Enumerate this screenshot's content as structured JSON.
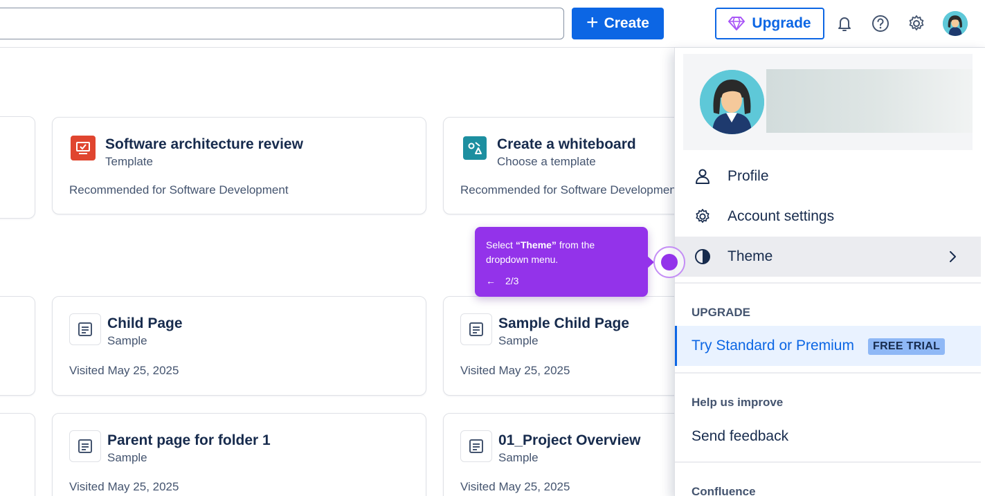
{
  "header": {
    "create_label": "Create",
    "upgrade_label": "Upgrade",
    "icons": [
      "bell-icon",
      "help-icon",
      "gear-icon",
      "avatar"
    ]
  },
  "cards": {
    "row1": [
      {
        "title": "Software architecture review",
        "subtitle": "Template",
        "footer": "Recommended for Software Development",
        "icon": "template-icon"
      },
      {
        "title": "Create a whiteboard",
        "subtitle": "Choose a template",
        "footer": "Recommended for Software Development",
        "icon": "whiteboard-icon"
      }
    ],
    "row2": [
      {
        "title": "Child Page",
        "subtitle": "Sample",
        "footer": "Visited May 25, 2025",
        "icon": "page-icon"
      },
      {
        "title": "Sample Child Page",
        "subtitle": "Sample",
        "footer": "Visited May 25, 2025",
        "icon": "page-icon"
      }
    ],
    "row3": [
      {
        "title": "Parent page for folder 1",
        "subtitle": "Sample",
        "footer": "Visited May 25, 2025",
        "icon": "page-icon"
      },
      {
        "title": "01_Project Overview",
        "subtitle": "Sample",
        "footer": "Visited May 25, 2025",
        "icon": "page-icon"
      }
    ]
  },
  "menu": {
    "items": [
      {
        "label": "Profile",
        "icon": "person-icon"
      },
      {
        "label": "Account settings",
        "icon": "gear-icon"
      },
      {
        "label": "Theme",
        "icon": "theme-icon"
      }
    ],
    "upgrade_section": "UPGRADE",
    "trial_label": "Try Standard or Premium",
    "trial_badge": "FREE TRIAL",
    "help_section": "Help us improve",
    "feedback_label": "Send feedback",
    "confluence_section": "Confluence"
  },
  "tooltip": {
    "prefix": "Select ",
    "bold": "“Theme”",
    "suffix": " from the dropdown menu.",
    "step": "2/3"
  },
  "colors": {
    "primary": "#0c66e4",
    "tooltip": "#9333ea",
    "template_icon": "#e0452f",
    "whiteboard_icon": "#1d8fa0"
  }
}
